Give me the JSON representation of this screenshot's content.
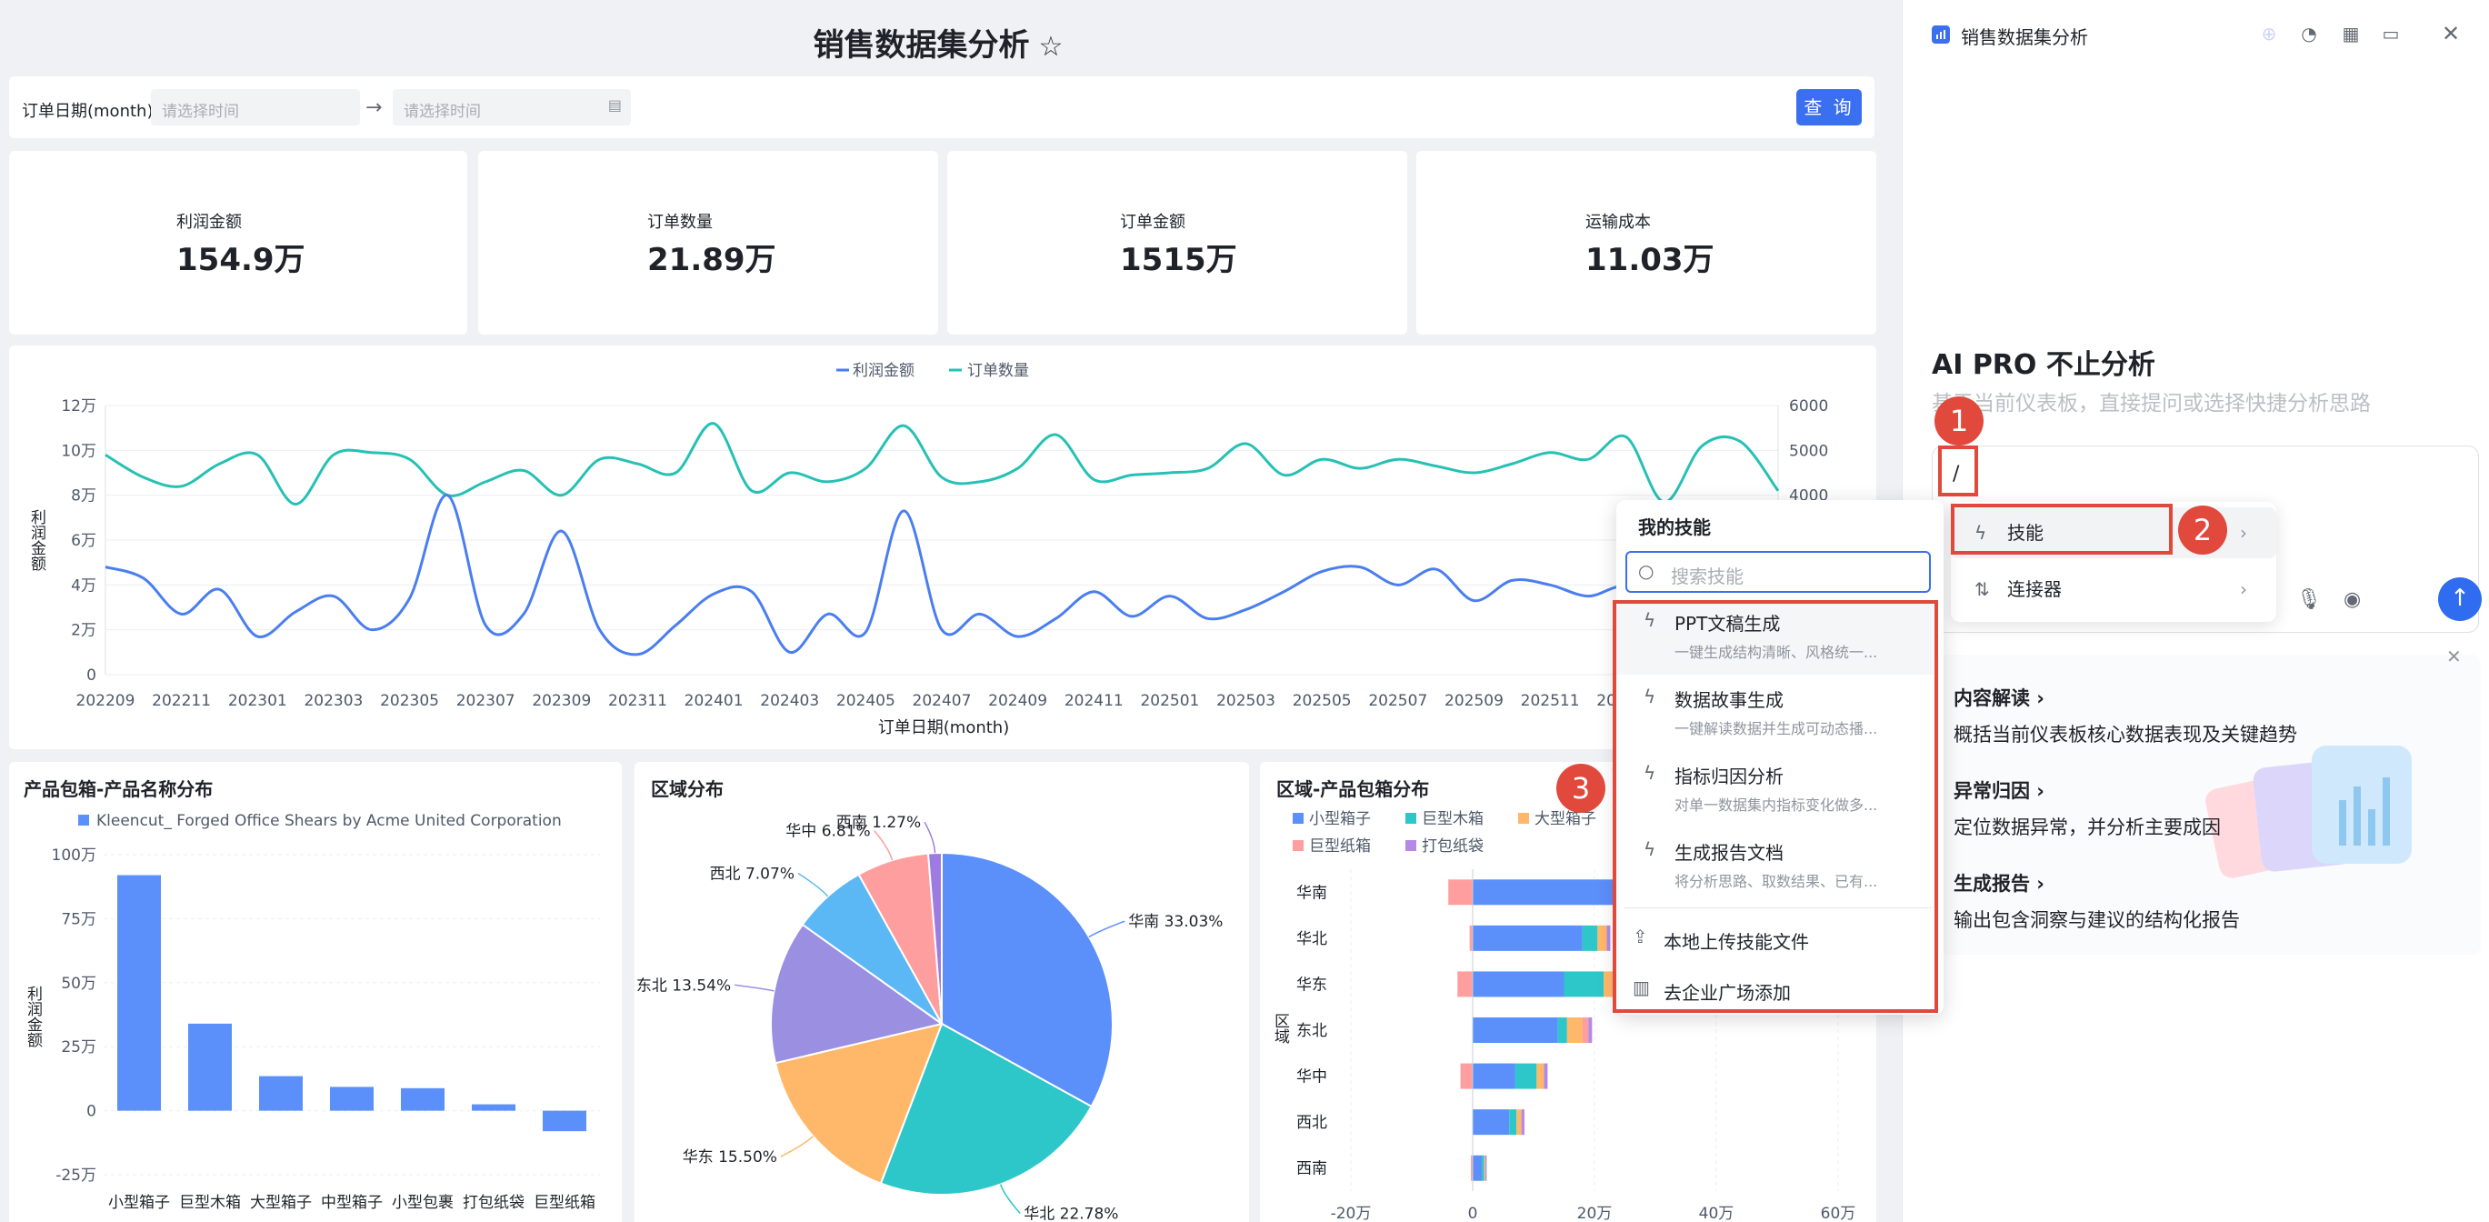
{
  "dashboard": {
    "title": "销售数据集分析",
    "filter": {
      "label": "订单日期(month)",
      "start_placeholder": "请选择时间",
      "end_placeholder": "请选择时间",
      "query": "查 询"
    },
    "kpis": [
      {
        "label": "利润金额",
        "value": "154.9万"
      },
      {
        "label": "订单数量",
        "value": "21.89万"
      },
      {
        "label": "订单金额",
        "value": "1515万"
      },
      {
        "label": "运输成本",
        "value": "11.03万"
      }
    ]
  },
  "line_chart": {
    "legend": [
      "利润金额",
      "订单数量"
    ],
    "ylabel": "利润金额",
    "xlabel": "订单日期(month)",
    "left_ticks": [
      "12万",
      "10万",
      "8万",
      "6万",
      "4万",
      "2万",
      "0"
    ],
    "right_ticks": [
      "6000",
      "5000",
      "4000"
    ],
    "x_ticks": [
      "202209",
      "202211",
      "202301",
      "202303",
      "202305",
      "202307",
      "202309",
      "202311",
      "202401",
      "202403",
      "202405",
      "202407",
      "202409",
      "202411",
      "202501",
      "202503",
      "202505",
      "202507",
      "202509",
      "202511",
      "202601",
      "202603"
    ]
  },
  "bar_chart": {
    "title": "产品包箱-产品名称分布",
    "legend": "Kleencut_ Forged Office Shears by Acme United Corporation",
    "ylabel": "利润金额",
    "y_ticks": [
      "100万",
      "75万",
      "50万",
      "25万",
      "0",
      "-25万"
    ]
  },
  "pie_chart": {
    "title": "区域分布"
  },
  "hbar_chart": {
    "title": "区域-产品包箱分布",
    "legend": [
      "小型箱子",
      "巨型木箱",
      "大型箱子",
      "巨型纸箱",
      "打包纸袋"
    ],
    "ylabel": "区域",
    "regions": [
      "华南",
      "华北",
      "华东",
      "东北",
      "华中",
      "西北",
      "西南"
    ],
    "x_ticks": [
      "-20万",
      "0",
      "20万",
      "40万",
      "60万"
    ]
  },
  "chart_data": [
    {
      "type": "line",
      "title": "",
      "xlabel": "订单日期(month)",
      "ylabel": "利润金额",
      "x": [
        "202209",
        "202210",
        "202211",
        "202212",
        "202301",
        "202302",
        "202303",
        "202304",
        "202305",
        "202306",
        "202307",
        "202308",
        "202309",
        "202310",
        "202311",
        "202312",
        "202401",
        "202402",
        "202403",
        "202404",
        "202405",
        "202406",
        "202407",
        "202408",
        "202409",
        "202410",
        "202411",
        "202412",
        "202501",
        "202502",
        "202503",
        "202504",
        "202505",
        "202506",
        "202507",
        "202508",
        "202509",
        "202510",
        "202511",
        "202512",
        "202601",
        "202602",
        "202603",
        "202604",
        "202605"
      ],
      "series": [
        {
          "name": "利润金额",
          "axis": "left",
          "ylim": [
            0,
            120000
          ],
          "values": [
            48000,
            43000,
            27000,
            38000,
            17000,
            28000,
            35000,
            20000,
            34000,
            80000,
            22000,
            27000,
            64000,
            20000,
            9000,
            22000,
            36000,
            37000,
            10000,
            27000,
            19000,
            73000,
            20000,
            27000,
            17000,
            25000,
            37000,
            26000,
            35000,
            25000,
            29000,
            37000,
            46000,
            48000,
            40000,
            47000,
            33000,
            42000,
            40000,
            35000,
            39000,
            25000,
            10000,
            15000,
            18000
          ]
        },
        {
          "name": "订单数量",
          "axis": "right",
          "ylim": [
            0,
            6000
          ],
          "values": [
            4900,
            4400,
            4200,
            4700,
            4900,
            3800,
            4900,
            4950,
            4800,
            4000,
            4300,
            4550,
            4000,
            4800,
            4700,
            4500,
            5600,
            4100,
            4500,
            4300,
            4600,
            5550,
            4400,
            4300,
            4600,
            5350,
            4350,
            4450,
            4500,
            4600,
            5150,
            4450,
            4800,
            4600,
            4800,
            4650,
            4500,
            4700,
            4950,
            4800,
            5300,
            3850,
            5100,
            5200,
            4100
          ]
        }
      ]
    },
    {
      "type": "bar",
      "title": "产品包箱-产品名称分布",
      "ylabel": "利润金额",
      "categories": [
        "小型箱子",
        "巨型木箱",
        "大型箱子",
        "中型箱子",
        "小型包裹",
        "打包纸袋",
        "巨型纸箱"
      ],
      "series": [
        {
          "name": "Kleencut_ Forged Office Shears by Acme United Corporation",
          "values": [
            920000,
            340000,
            135000,
            93000,
            88000,
            25000,
            -80000
          ]
        }
      ],
      "ylim": [
        -250000,
        1000000
      ]
    },
    {
      "type": "pie",
      "title": "区域分布",
      "categories": [
        "华南",
        "华北",
        "华东",
        "东北",
        "西北",
        "华中",
        "西南"
      ],
      "values": [
        33.03,
        22.78,
        15.5,
        13.54,
        7.07,
        6.81,
        1.27
      ],
      "labels": [
        "华南 33.03%",
        "华北 22.78%",
        "华东 15.50%",
        "东北 13.54%",
        "西北 7.07%",
        "华中 6.81%",
        "西南 1.27%"
      ],
      "colors": [
        "#5b8ff9",
        "#2ec7c9",
        "#ffb86a",
        "#9b8fe2",
        "#5cb8f5",
        "#ff9e9e",
        "#9d7be0"
      ]
    },
    {
      "type": "bar",
      "orientation": "horizontal",
      "stacked": true,
      "title": "区域-产品包箱分布",
      "ylabel": "区域",
      "categories": [
        "华南",
        "华北",
        "华东",
        "东北",
        "华中",
        "西北",
        "西南"
      ],
      "series": [
        {
          "name": "小型箱子",
          "values": [
            240000,
            180000,
            150000,
            140000,
            70000,
            60000,
            15000
          ]
        },
        {
          "name": "巨型木箱",
          "values": [
            30000,
            25000,
            65000,
            15000,
            35000,
            12000,
            4000
          ]
        },
        {
          "name": "大型箱子",
          "values": [
            20000,
            15000,
            25000,
            25000,
            12000,
            8000,
            2000
          ]
        },
        {
          "name": "巨型纸箱",
          "values": [
            -40000,
            -5000,
            -25000,
            10000,
            -20000,
            0,
            -3000
          ]
        },
        {
          "name": "打包纸袋",
          "values": [
            8000,
            6000,
            8000,
            6000,
            6000,
            5000,
            2000
          ]
        }
      ],
      "xlim": [
        -200000,
        600000
      ]
    }
  ],
  "ai_panel": {
    "title": "销售数据集分析",
    "heading": "AI PRO 不止分析",
    "subtitle": "基于当前仪表板，直接提问或选择快捷分析思路",
    "input_value": "/",
    "menu": [
      {
        "label": "技能"
      },
      {
        "label": "连接器"
      }
    ],
    "features": [
      {
        "title": "内容解读",
        "desc": "概括当前仪表板核心数据表现及关键趋势"
      },
      {
        "title": "异常归因",
        "desc": "定位数据异常，并分析主要成因"
      },
      {
        "title": "生成报告",
        "desc": "输出包含洞察与建议的结构化报告"
      }
    ]
  },
  "skills_popup": {
    "title": "我的技能",
    "search_placeholder": "搜索技能",
    "skills": [
      {
        "name": "PPT文稿生成",
        "desc": "一键生成结构清晰、风格统一..."
      },
      {
        "name": "数据故事生成",
        "desc": "一键解读数据并生成可动态播..."
      },
      {
        "name": "指标归因分析",
        "desc": "对单一数据集内指标变化做多..."
      },
      {
        "name": "生成报告文档",
        "desc": "将分析思路、取数结果、已有..."
      }
    ],
    "actions": [
      {
        "label": "本地上传技能文件"
      },
      {
        "label": "去企业广场添加"
      }
    ]
  },
  "steps": [
    "1",
    "2",
    "3"
  ],
  "colors": {
    "accent": "#3a6ff0",
    "profit_line": "#4a7ef0",
    "orders_line": "#26c1b4",
    "bar": "#5b8ff9",
    "annotation": "#e0493c"
  }
}
